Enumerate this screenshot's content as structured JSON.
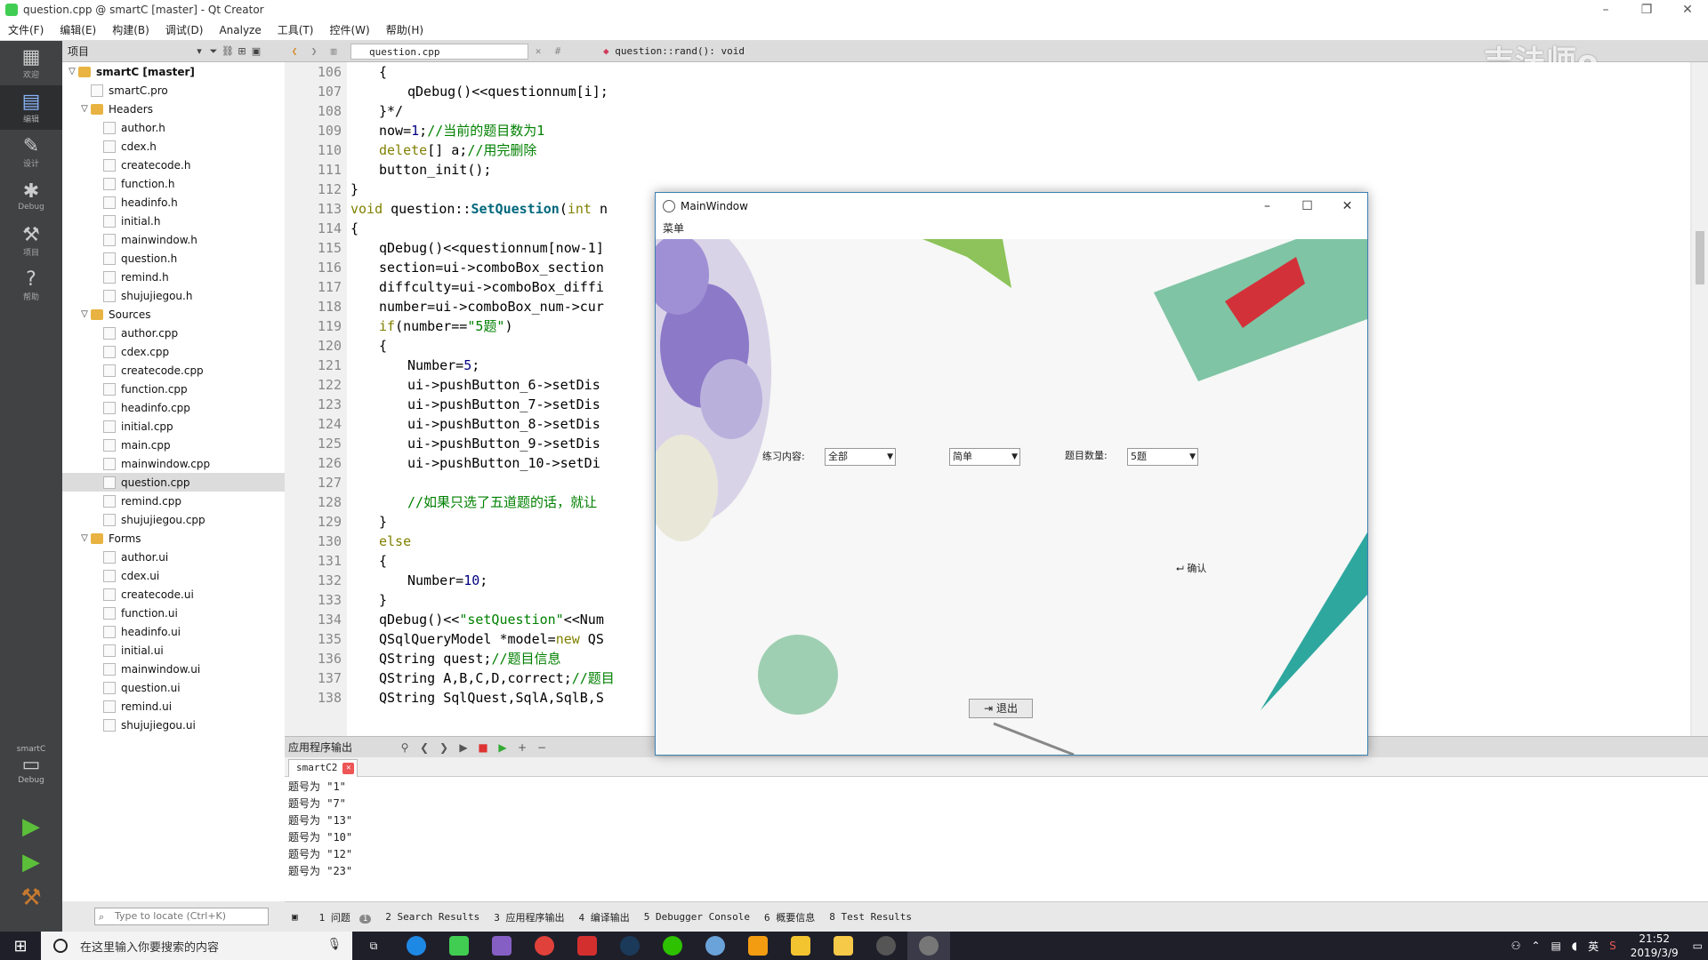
{
  "app": {
    "title": "question.cpp @ smartC [master] - Qt Creator"
  },
  "menu": [
    "文件(F)",
    "编辑(E)",
    "构建(B)",
    "调试(D)",
    "Analyze",
    "工具(T)",
    "控件(W)",
    "帮助(H)"
  ],
  "modes": [
    {
      "label": "欢迎",
      "icon": "grid-icon"
    },
    {
      "label": "编辑",
      "icon": "edit-icon"
    },
    {
      "label": "设计",
      "icon": "pen-icon"
    },
    {
      "label": "Debug",
      "icon": "bug-icon"
    },
    {
      "label": "项目",
      "icon": "wrench-icon"
    },
    {
      "label": "帮助",
      "icon": "help-icon"
    }
  ],
  "kit": {
    "project": "smartC",
    "config": "Debug"
  },
  "project": {
    "header": "项目",
    "tree": [
      {
        "label": "smartC [master]",
        "level": 0,
        "type": "project",
        "arrow": "▽",
        "bold": true
      },
      {
        "label": "smartC.pro",
        "level": 1,
        "type": "file"
      },
      {
        "label": "Headers",
        "level": 1,
        "type": "folder",
        "arrow": "▽"
      },
      {
        "label": "author.h",
        "level": 2,
        "type": "h"
      },
      {
        "label": "cdex.h",
        "level": 2,
        "type": "h"
      },
      {
        "label": "createcode.h",
        "level": 2,
        "type": "h"
      },
      {
        "label": "function.h",
        "level": 2,
        "type": "h"
      },
      {
        "label": "headinfo.h",
        "level": 2,
        "type": "h"
      },
      {
        "label": "initial.h",
        "level": 2,
        "type": "h"
      },
      {
        "label": "mainwindow.h",
        "level": 2,
        "type": "h"
      },
      {
        "label": "question.h",
        "level": 2,
        "type": "h"
      },
      {
        "label": "remind.h",
        "level": 2,
        "type": "h"
      },
      {
        "label": "shujujiegou.h",
        "level": 2,
        "type": "h"
      },
      {
        "label": "Sources",
        "level": 1,
        "type": "folder",
        "arrow": "▽"
      },
      {
        "label": "author.cpp",
        "level": 2,
        "type": "cpp"
      },
      {
        "label": "cdex.cpp",
        "level": 2,
        "type": "cpp"
      },
      {
        "label": "createcode.cpp",
        "level": 2,
        "type": "cpp"
      },
      {
        "label": "function.cpp",
        "level": 2,
        "type": "cpp"
      },
      {
        "label": "headinfo.cpp",
        "level": 2,
        "type": "cpp"
      },
      {
        "label": "initial.cpp",
        "level": 2,
        "type": "cpp"
      },
      {
        "label": "main.cpp",
        "level": 2,
        "type": "cpp"
      },
      {
        "label": "mainwindow.cpp",
        "level": 2,
        "type": "cpp"
      },
      {
        "label": "question.cpp",
        "level": 2,
        "type": "cpp",
        "selected": true
      },
      {
        "label": "remind.cpp",
        "level": 2,
        "type": "cpp"
      },
      {
        "label": "shujujiegou.cpp",
        "level": 2,
        "type": "cpp"
      },
      {
        "label": "Forms",
        "level": 1,
        "type": "folder",
        "arrow": "▽"
      },
      {
        "label": "author.ui",
        "level": 2,
        "type": "ui"
      },
      {
        "label": "cdex.ui",
        "level": 2,
        "type": "ui"
      },
      {
        "label": "createcode.ui",
        "level": 2,
        "type": "ui"
      },
      {
        "label": "function.ui",
        "level": 2,
        "type": "ui"
      },
      {
        "label": "headinfo.ui",
        "level": 2,
        "type": "ui"
      },
      {
        "label": "initial.ui",
        "level": 2,
        "type": "ui"
      },
      {
        "label": "mainwindow.ui",
        "level": 2,
        "type": "ui"
      },
      {
        "label": "question.ui",
        "level": 2,
        "type": "ui"
      },
      {
        "label": "remind.ui",
        "level": 2,
        "type": "ui"
      },
      {
        "label": "shujujiegou.ui",
        "level": 2,
        "type": "ui"
      }
    ]
  },
  "editor": {
    "file": "question.cpp",
    "function": "question::rand(): void",
    "lines": [
      {
        "n": "106",
        "fold": "",
        "indent": 1,
        "parts": [
          [
            "",
            "{"
          ]
        ]
      },
      {
        "n": "107",
        "fold": "",
        "indent": 2,
        "parts": [
          [
            "",
            "qDebug()<<questionnum[i];"
          ]
        ]
      },
      {
        "n": "108",
        "fold": "",
        "indent": 1,
        "parts": [
          [
            "",
            "}*/"
          ]
        ]
      },
      {
        "n": "109",
        "fold": "",
        "indent": 1,
        "parts": [
          [
            "",
            "now="
          ],
          [
            "nm",
            "1"
          ],
          [
            "",
            ";"
          ],
          [
            "cm",
            "//当前的题目数为1"
          ]
        ]
      },
      {
        "n": "110",
        "fold": "",
        "indent": 1,
        "parts": [
          [
            "kw",
            "delete"
          ],
          [
            "",
            "[] a;"
          ],
          [
            "cm",
            "//用完删除"
          ]
        ]
      },
      {
        "n": "111",
        "fold": "",
        "indent": 1,
        "parts": [
          [
            "",
            "button_init();"
          ]
        ]
      },
      {
        "n": "112",
        "fold": "",
        "indent": 0,
        "parts": [
          [
            "",
            "}"
          ]
        ]
      },
      {
        "n": "113",
        "fold": "▼",
        "indent": 0,
        "parts": [
          [
            "kw",
            "void"
          ],
          [
            "",
            " question::"
          ],
          [
            "fn",
            "SetQuestion"
          ],
          [
            "",
            "("
          ],
          [
            "kw",
            "int"
          ],
          [
            "",
            " n"
          ]
        ]
      },
      {
        "n": "114",
        "fold": "",
        "indent": 0,
        "parts": [
          [
            "",
            "{"
          ]
        ]
      },
      {
        "n": "115",
        "fold": "",
        "indent": 1,
        "parts": [
          [
            "",
            "qDebug()<<questionnum[now-1]"
          ]
        ]
      },
      {
        "n": "116",
        "fold": "",
        "indent": 1,
        "parts": [
          [
            "",
            "section=ui->comboBox_section"
          ]
        ]
      },
      {
        "n": "117",
        "fold": "",
        "indent": 1,
        "parts": [
          [
            "",
            "diffculty=ui->comboBox_diffi"
          ]
        ]
      },
      {
        "n": "118",
        "fold": "",
        "indent": 1,
        "parts": [
          [
            "",
            "number=ui->comboBox_num->cur"
          ]
        ]
      },
      {
        "n": "119",
        "fold": "▼",
        "indent": 1,
        "parts": [
          [
            "kw",
            "if"
          ],
          [
            "",
            "(number=="
          ],
          [
            "st",
            "\"5题\""
          ],
          [
            "",
            ")"
          ]
        ]
      },
      {
        "n": "120",
        "fold": "",
        "indent": 1,
        "parts": [
          [
            "",
            "{"
          ]
        ]
      },
      {
        "n": "121",
        "fold": "",
        "indent": 2,
        "parts": [
          [
            "",
            "Number="
          ],
          [
            "nm",
            "5"
          ],
          [
            "",
            ";"
          ]
        ]
      },
      {
        "n": "122",
        "fold": "",
        "indent": 2,
        "parts": [
          [
            "",
            "ui->pushButton_6->setDis"
          ]
        ]
      },
      {
        "n": "123",
        "fold": "",
        "indent": 2,
        "parts": [
          [
            "",
            "ui->pushButton_7->setDis"
          ]
        ]
      },
      {
        "n": "124",
        "fold": "",
        "indent": 2,
        "parts": [
          [
            "",
            "ui->pushButton_8->setDis"
          ]
        ]
      },
      {
        "n": "125",
        "fold": "",
        "indent": 2,
        "parts": [
          [
            "",
            "ui->pushButton_9->setDis"
          ]
        ]
      },
      {
        "n": "126",
        "fold": "",
        "indent": 2,
        "parts": [
          [
            "",
            "ui->pushButton_10->setDi"
          ]
        ]
      },
      {
        "n": "127",
        "fold": "",
        "indent": 0,
        "parts": [
          [
            "",
            ""
          ]
        ]
      },
      {
        "n": "128",
        "fold": "",
        "indent": 2,
        "parts": [
          [
            "cm",
            "//如果只选了五道题的话，就让"
          ]
        ]
      },
      {
        "n": "129",
        "fold": "",
        "indent": 1,
        "parts": [
          [
            "",
            "}"
          ]
        ]
      },
      {
        "n": "130",
        "fold": "▼",
        "indent": 1,
        "parts": [
          [
            "kw",
            "else"
          ]
        ]
      },
      {
        "n": "131",
        "fold": "",
        "indent": 1,
        "parts": [
          [
            "",
            "{"
          ]
        ]
      },
      {
        "n": "132",
        "fold": "",
        "indent": 2,
        "parts": [
          [
            "",
            "Number="
          ],
          [
            "nm",
            "10"
          ],
          [
            "",
            ";"
          ]
        ]
      },
      {
        "n": "133",
        "fold": "",
        "indent": 1,
        "parts": [
          [
            "",
            "}"
          ]
        ]
      },
      {
        "n": "134",
        "fold": "",
        "indent": 1,
        "parts": [
          [
            "",
            "qDebug()<<"
          ],
          [
            "st",
            "\"setQuestion\""
          ],
          [
            "",
            "<<Num"
          ]
        ]
      },
      {
        "n": "135",
        "fold": "",
        "indent": 1,
        "parts": [
          [
            "",
            "QSqlQueryModel *model="
          ],
          [
            "kw",
            "new"
          ],
          [
            "",
            " QS"
          ]
        ]
      },
      {
        "n": "136",
        "fold": "",
        "indent": 1,
        "parts": [
          [
            "",
            "QString quest;"
          ],
          [
            "cm",
            "//题目信息"
          ]
        ]
      },
      {
        "n": "137",
        "fold": "",
        "indent": 1,
        "parts": [
          [
            "",
            "QString A,B,C,D,correct;"
          ],
          [
            "cm",
            "//题目"
          ]
        ]
      },
      {
        "n": "138",
        "fold": "",
        "indent": 1,
        "parts": [
          [
            "",
            "QString SqlQuest,SqlA,SqlB,S"
          ]
        ]
      }
    ]
  },
  "output": {
    "header": "应用程序输出",
    "tab": "smartC2",
    "lines": [
      "题号为 \"1\"",
      "题号为 \"7\"",
      "题号为 \"13\"",
      "题号为 \"10\"",
      "题号为 \"12\"",
      "题号为 \"23\""
    ]
  },
  "locator": {
    "placeholder": "Type to locate (Ctrl+K)"
  },
  "bottom_tabs": [
    {
      "label": "1 问题",
      "count": "1"
    },
    {
      "label": "2 Search Results"
    },
    {
      "label": "3 应用程序输出"
    },
    {
      "label": "4 编译输出"
    },
    {
      "label": "5 Debugger Console"
    },
    {
      "label": "6 概要信息"
    },
    {
      "label": "8 Test Results"
    }
  ],
  "watermark": "吉法师o bilibili",
  "mainwindow": {
    "title": "MainWindow",
    "menu": "菜单",
    "label_section": "练习内容:",
    "section_value": "全部",
    "difficulty_value": "简单",
    "label_count": "题目数量:",
    "count_value": "5题",
    "ok_label": "确认",
    "quit_label": "退出"
  },
  "taskbar": {
    "search_placeholder": "在这里输入你要搜索的内容",
    "time": "21:52",
    "date": "2019/3/9",
    "ime": "英"
  }
}
